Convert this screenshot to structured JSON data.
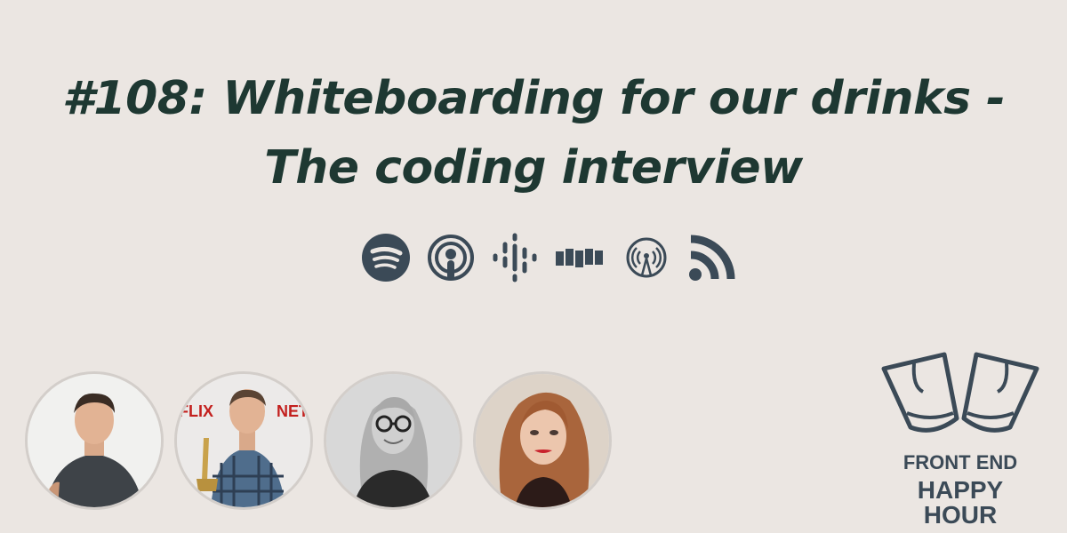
{
  "episode": {
    "title_line1": "#108: Whiteboarding for our drinks -",
    "title_line2": "The coding interview"
  },
  "platforms": [
    "spotify-icon",
    "apple-podcasts-icon",
    "google-podcasts-icon",
    "stitcher-icon",
    "overcast-icon",
    "rss-icon"
  ],
  "hosts": [
    "host-avatar-1",
    "host-avatar-2",
    "host-avatar-3",
    "host-avatar-4"
  ],
  "brand": {
    "line1": "FRONT END",
    "line2": "HAPPY HOUR",
    "text_color": "#3b4a57"
  },
  "colors": {
    "background": "#ebe6e2",
    "title": "#1e3832",
    "icon": "#3b4a57"
  }
}
